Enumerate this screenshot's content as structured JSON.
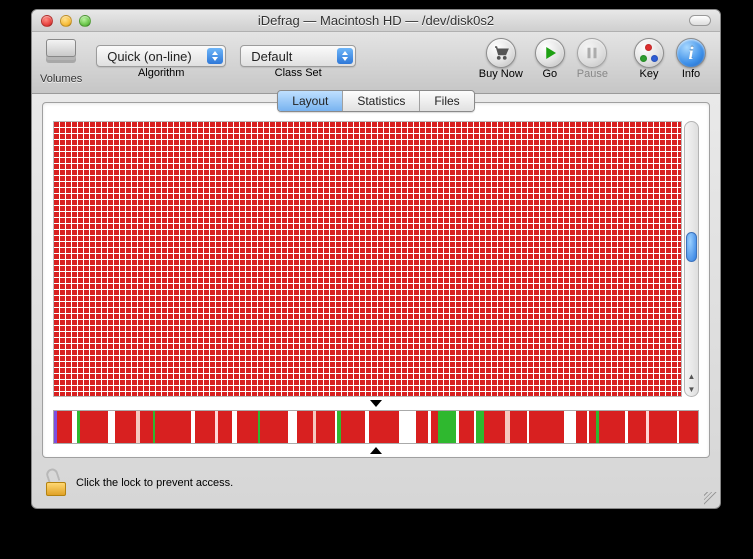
{
  "window": {
    "title": "iDefrag — Macintosh HD — /dev/disk0s2"
  },
  "toolbar": {
    "volumes_label": "Volumes",
    "algorithm_label": "Algorithm",
    "algorithm_value": "Quick (on-line)",
    "classset_label": "Class Set",
    "classset_value": "Default",
    "buynow_label": "Buy Now",
    "go_label": "Go",
    "pause_label": "Pause",
    "key_label": "Key",
    "info_label": "Info"
  },
  "tabs": {
    "layout": "Layout",
    "statistics": "Statistics",
    "files": "Files",
    "active": "Layout"
  },
  "lock_text": "Click the lock to prevent access.",
  "overview_stripes": [
    {
      "c": "#7b4fe0",
      "w": 0.4
    },
    {
      "c": "#d82020",
      "w": 2.2
    },
    {
      "c": "#ffffff",
      "w": 0.7
    },
    {
      "c": "#2fb82f",
      "w": 0.5
    },
    {
      "c": "#d82020",
      "w": 4.0
    },
    {
      "c": "#ffffff",
      "w": 1.0
    },
    {
      "c": "#d82020",
      "w": 3.1
    },
    {
      "c": "#f5c9c0",
      "w": 0.6
    },
    {
      "c": "#d82020",
      "w": 1.8
    },
    {
      "c": "#2fb82f",
      "w": 0.4
    },
    {
      "c": "#d82020",
      "w": 5.2
    },
    {
      "c": "#ffffff",
      "w": 0.5
    },
    {
      "c": "#d82020",
      "w": 2.9
    },
    {
      "c": "#ffd6d6",
      "w": 0.5
    },
    {
      "c": "#d82020",
      "w": 2.0
    },
    {
      "c": "#ffffff",
      "w": 0.8
    },
    {
      "c": "#d82020",
      "w": 3.0
    },
    {
      "c": "#2fb82f",
      "w": 0.3
    },
    {
      "c": "#d82020",
      "w": 4.0
    },
    {
      "c": "#ffffff",
      "w": 1.4
    },
    {
      "c": "#d82020",
      "w": 2.3
    },
    {
      "c": "#f5c9c0",
      "w": 0.4
    },
    {
      "c": "#d82020",
      "w": 2.8
    },
    {
      "c": "#ffffff",
      "w": 0.3
    },
    {
      "c": "#2fb82f",
      "w": 0.6
    },
    {
      "c": "#d82020",
      "w": 3.5
    },
    {
      "c": "#ffffff",
      "w": 0.5
    },
    {
      "c": "#d82020",
      "w": 4.4
    },
    {
      "c": "#ffffff",
      "w": 2.4
    },
    {
      "c": "#d82020",
      "w": 1.8
    },
    {
      "c": "#ffffff",
      "w": 0.4
    },
    {
      "c": "#d82020",
      "w": 1.0
    },
    {
      "c": "#2fb82f",
      "w": 2.6
    },
    {
      "c": "#ffffff",
      "w": 0.5
    },
    {
      "c": "#d82020",
      "w": 2.1
    },
    {
      "c": "#ffffff",
      "w": 0.3
    },
    {
      "c": "#2fb82f",
      "w": 1.2
    },
    {
      "c": "#d82020",
      "w": 3.0
    },
    {
      "c": "#f5c9c0",
      "w": 0.8
    },
    {
      "c": "#d82020",
      "w": 2.4
    },
    {
      "c": "#ffffff",
      "w": 0.3
    },
    {
      "c": "#d82020",
      "w": 5.1
    },
    {
      "c": "#ffffff",
      "w": 1.8
    },
    {
      "c": "#d82020",
      "w": 1.6
    },
    {
      "c": "#ffffff",
      "w": 0.3
    },
    {
      "c": "#d82020",
      "w": 0.9
    },
    {
      "c": "#2fb82f",
      "w": 0.5
    },
    {
      "c": "#d82020",
      "w": 3.8
    },
    {
      "c": "#ffffff",
      "w": 0.4
    },
    {
      "c": "#d82020",
      "w": 2.6
    },
    {
      "c": "#ffd6d6",
      "w": 0.5
    },
    {
      "c": "#d82020",
      "w": 4.0
    },
    {
      "c": "#ffffff",
      "w": 0.3
    },
    {
      "c": "#d82020",
      "w": 2.7
    }
  ]
}
